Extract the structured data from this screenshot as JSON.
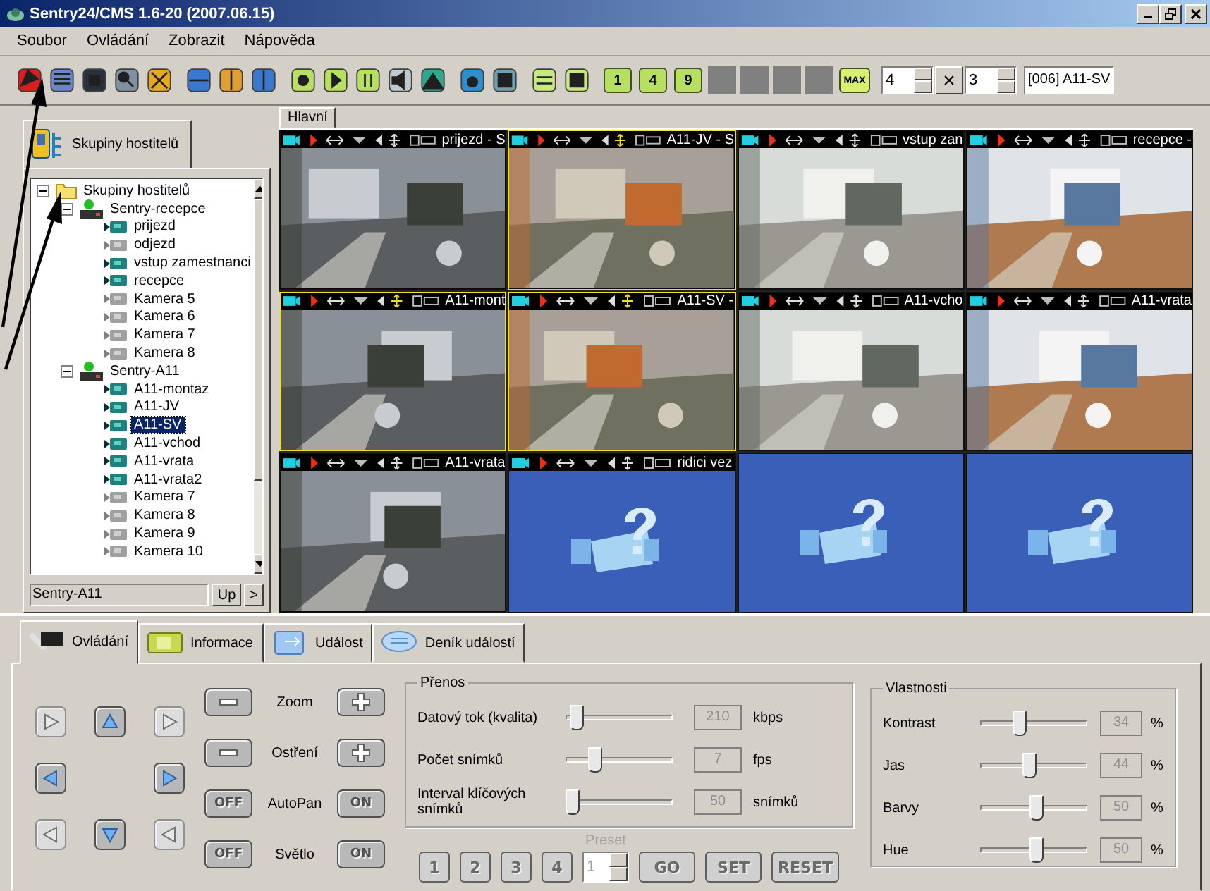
{
  "window": {
    "title": "Sentry24/CMS 1.6-20 (2007.06.15)"
  },
  "menu": [
    "Soubor",
    "Ovládání",
    "Zobrazit",
    "Nápověda"
  ],
  "toolbar": {
    "numbers": [
      "1",
      "4",
      "9"
    ],
    "max": "MAX",
    "rows": "4",
    "times": "×",
    "cols": "3",
    "camera": "[006] A11-SV"
  },
  "left_panel": {
    "tab": "Skupiny hostitelů",
    "tree": {
      "label": "Skupiny hostitelů",
      "kind": "group",
      "expanded": true,
      "children": [
        {
          "label": "Sentry-recepce",
          "kind": "host",
          "expanded": true,
          "children": [
            {
              "label": "prijezd",
              "kind": "camera",
              "active": true,
              "selected": false
            },
            {
              "label": "odjezd",
              "kind": "camera",
              "active": false,
              "selected": false
            },
            {
              "label": "vstup zamestnanci",
              "kind": "camera",
              "active": true,
              "selected": false
            },
            {
              "label": "recepce",
              "kind": "camera",
              "active": true,
              "selected": false
            },
            {
              "label": "Kamera 5",
              "kind": "camera",
              "active": false,
              "selected": false
            },
            {
              "label": "Kamera 6",
              "kind": "camera",
              "active": false,
              "selected": false
            },
            {
              "label": "Kamera 7",
              "kind": "camera",
              "active": false,
              "selected": false
            },
            {
              "label": "Kamera 8",
              "kind": "camera",
              "active": false,
              "selected": false
            }
          ]
        },
        {
          "label": "Sentry-A11",
          "kind": "host",
          "expanded": true,
          "children": [
            {
              "label": "A11-montaz",
              "kind": "camera",
              "active": true,
              "selected": false
            },
            {
              "label": "A11-JV",
              "kind": "camera",
              "active": true,
              "selected": false
            },
            {
              "label": "A11-SV",
              "kind": "camera",
              "active": true,
              "selected": true
            },
            {
              "label": "A11-vchod",
              "kind": "camera",
              "active": true,
              "selected": false
            },
            {
              "label": "A11-vrata",
              "kind": "camera",
              "active": true,
              "selected": false
            },
            {
              "label": "A11-vrata2",
              "kind": "camera",
              "active": true,
              "selected": false
            },
            {
              "label": "Kamera 7",
              "kind": "camera",
              "active": false,
              "selected": false
            },
            {
              "label": "Kamera 8",
              "kind": "camera",
              "active": false,
              "selected": false
            },
            {
              "label": "Kamera 9",
              "kind": "camera",
              "active": false,
              "selected": false
            },
            {
              "label": "Kamera 10",
              "kind": "camera",
              "active": false,
              "selected": false
            }
          ]
        }
      ]
    },
    "path_field": "Sentry-A11",
    "up_button": "Up",
    "next_button": ">"
  },
  "view_tab": "Hlavní",
  "cells": [
    {
      "kind": "video",
      "label": "prijezd - S",
      "selected": false
    },
    {
      "kind": "video",
      "label": "A11-JV - S",
      "selected": true
    },
    {
      "kind": "video",
      "label": "vstup zan",
      "selected": false
    },
    {
      "kind": "video",
      "label": "recepce -",
      "selected": false
    },
    {
      "kind": "video",
      "label": "A11-mont",
      "selected": true
    },
    {
      "kind": "video",
      "label": "A11-SV -",
      "selected": true
    },
    {
      "kind": "video",
      "label": "A11-vcho",
      "selected": false
    },
    {
      "kind": "video",
      "label": "A11-vrata",
      "selected": false
    },
    {
      "kind": "video",
      "label": "A11-vrata",
      "selected": false
    },
    {
      "kind": "no_signal",
      "label": "ridici vez",
      "selected": false
    },
    {
      "kind": "no_signal",
      "selected": false
    },
    {
      "kind": "no_signal",
      "selected": false
    }
  ],
  "bottom_tabs": [
    {
      "label": "Ovládání",
      "kind": "control",
      "selected": true
    },
    {
      "label": "Informace",
      "kind": "info",
      "selected": false
    },
    {
      "label": "Událost",
      "kind": "event",
      "selected": false
    },
    {
      "label": "Deník událostí",
      "kind": "log",
      "selected": false
    }
  ],
  "ptz": [
    {
      "kind": "up-left"
    },
    {
      "kind": "up"
    },
    {
      "kind": "up-right"
    },
    {
      "kind": "left"
    },
    {
      "kind": "none"
    },
    {
      "kind": "right"
    },
    {
      "kind": "down-left"
    },
    {
      "kind": "down"
    },
    {
      "kind": "down-right"
    }
  ],
  "lens": [
    {
      "kind": "stepper",
      "label": "Zoom"
    },
    {
      "kind": "stepper",
      "label": "Ostření"
    },
    {
      "kind": "toggle",
      "label": "AutoPan",
      "off": "OFF",
      "on": "ON"
    },
    {
      "kind": "toggle",
      "label": "Světlo",
      "off": "OFF",
      "on": "ON"
    }
  ],
  "transfer": {
    "title": "Přenos",
    "rows": [
      {
        "label": "Datový tok (kvalita)",
        "level": 0.15,
        "value": "210",
        "unit": "kbps"
      },
      {
        "label": "Počet snímků",
        "level": 0.3,
        "value": "7",
        "unit": "fps"
      },
      {
        "label": "Interval klíčových snímků",
        "level": 0.12,
        "value": "50",
        "unit": "snímků"
      }
    ]
  },
  "preset": {
    "label": "Preset",
    "buttons": [
      "1",
      "2",
      "3",
      "4"
    ],
    "value": "1",
    "go": "GO",
    "set": "SET",
    "reset": "RESET",
    "disabled": true
  },
  "properties": {
    "title": "Vlastnosti",
    "rows": [
      {
        "label": "Kontrast",
        "level": 0.38,
        "value": "34",
        "unit": "%"
      },
      {
        "label": "Jas",
        "level": 0.46,
        "value": "44",
        "unit": "%"
      },
      {
        "label": "Barvy",
        "level": 0.52,
        "value": "50",
        "unit": "%"
      },
      {
        "label": "Hue",
        "level": 0.52,
        "value": "50",
        "unit": "%"
      }
    ]
  }
}
